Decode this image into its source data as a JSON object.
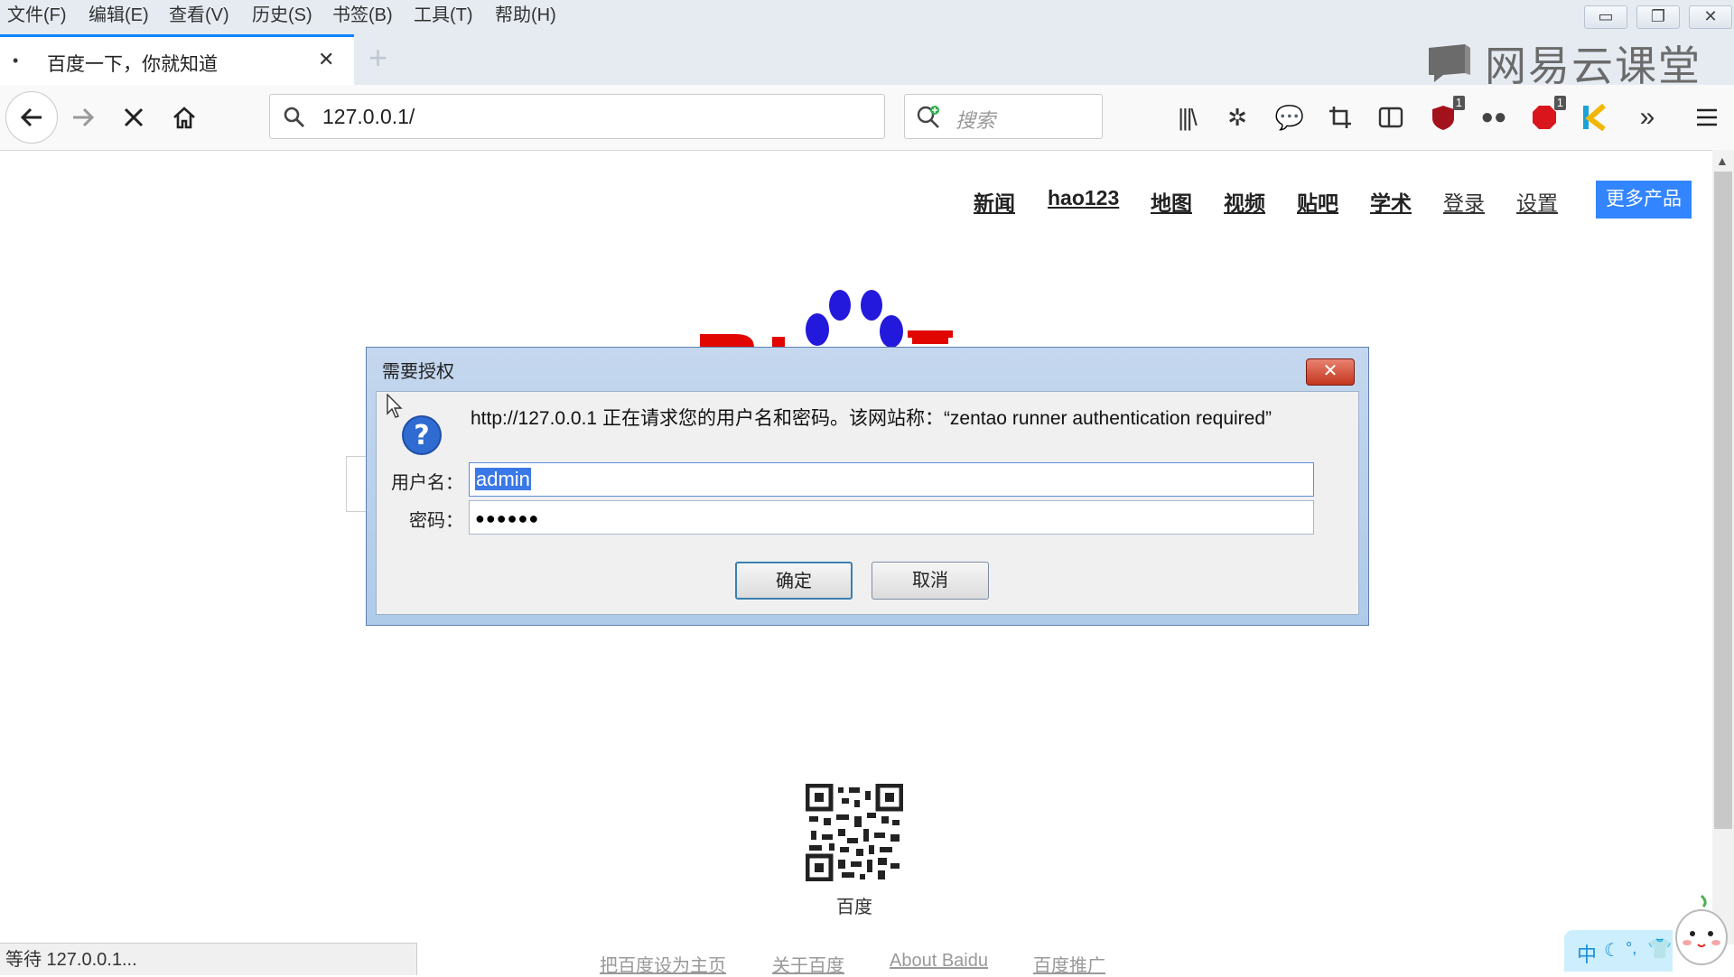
{
  "menubar": {
    "items": [
      "文件(F)",
      "编辑(E)",
      "查看(V)",
      "历史(S)",
      "书签(B)",
      "工具(T)",
      "帮助(H)"
    ],
    "window_controls": {
      "minimize": "▭",
      "restore": "❐",
      "close": "✕"
    }
  },
  "tab": {
    "title": "百度一下，你就知道",
    "close_glyph": "✕",
    "new_tab_glyph": "+"
  },
  "watermark": {
    "text": "网易云课堂"
  },
  "toolbar": {
    "url": "127.0.0.1/",
    "search_placeholder": "搜索",
    "badge_count_1": "1",
    "badge_count_2": "1"
  },
  "page": {
    "nav": [
      "新闻",
      "hao123",
      "地图",
      "视频",
      "贴吧",
      "学术",
      "登录",
      "设置"
    ],
    "more_products": "更多产品",
    "qr_caption": "百度",
    "footer": [
      "把百度设为主页",
      "关于百度",
      "About  Baidu",
      "百度推广"
    ]
  },
  "dialog": {
    "title": "需要授权",
    "message": "http://127.0.0.1 正在请求您的用户名和密码。该网站称：“zentao runner authentication required”",
    "username_label": "用户名：",
    "username_value": "admin",
    "password_label": "密码：",
    "password_value": "●●●●●●",
    "ok_label": "确定",
    "cancel_label": "取消"
  },
  "status": {
    "text": "等待 127.0.0.1..."
  },
  "ime": {
    "text": "中"
  },
  "colors": {
    "accent": "#0a84ff",
    "baidu_blue": "#3385ff",
    "baidu_red": "#e10602",
    "paw_blue": "#2319dc"
  }
}
